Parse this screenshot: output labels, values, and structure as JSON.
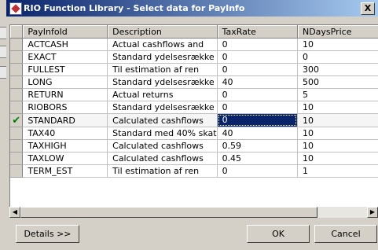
{
  "window": {
    "title": "RIO Function Library - Select data for PayInfo",
    "close_glyph": "X",
    "app_icon": "rio-app-icon"
  },
  "grid": {
    "columns": [
      "PayInfoId",
      "Description",
      "TaxRate",
      "NDaysPrice"
    ],
    "rows": [
      {
        "id": "ACTCASH",
        "desc": "Actual cashflows and",
        "tax": "0",
        "ndays": "10"
      },
      {
        "id": "EXACT",
        "desc": "Standard ydelsesrække",
        "tax": "0",
        "ndays": "0"
      },
      {
        "id": "FULLEST",
        "desc": "Til estimation af ren",
        "tax": "0",
        "ndays": "300"
      },
      {
        "id": "LONG",
        "desc": "Standard ydelsesrække",
        "tax": "40",
        "ndays": "500"
      },
      {
        "id": "RETURN",
        "desc": "Actual returns",
        "tax": "0",
        "ndays": "5"
      },
      {
        "id": "RIOBORS",
        "desc": "Standard ydelsesrække",
        "tax": "0",
        "ndays": "10"
      },
      {
        "id": "STANDARD",
        "desc": "Calculated cashflows",
        "tax": "0",
        "ndays": "10",
        "selected": true
      },
      {
        "id": "TAX40",
        "desc": "Standard med 40% skat",
        "tax": "40",
        "ndays": "10"
      },
      {
        "id": "TAXHIGH",
        "desc": "Calculated cashflows",
        "tax": "0.59",
        "ndays": "10"
      },
      {
        "id": "TAXLOW",
        "desc": "Calculated cashflows",
        "tax": "0.45",
        "ndays": "10"
      },
      {
        "id": "TERM_EST",
        "desc": "Til estimation af ren",
        "tax": "0",
        "ndays": "1"
      }
    ],
    "selected_marker": "✔"
  },
  "scrollbar": {
    "left_arrow": "◀",
    "right_arrow": "▶"
  },
  "buttons": {
    "details_label": "Details >>",
    "ok_label": "OK",
    "cancel_label": "Cancel"
  },
  "colors": {
    "title_gradient_start": "#0a246a",
    "title_gradient_end": "#a6caf0",
    "selection": "#0a246a",
    "check_green": "#008000",
    "face": "#d4d0c8"
  }
}
